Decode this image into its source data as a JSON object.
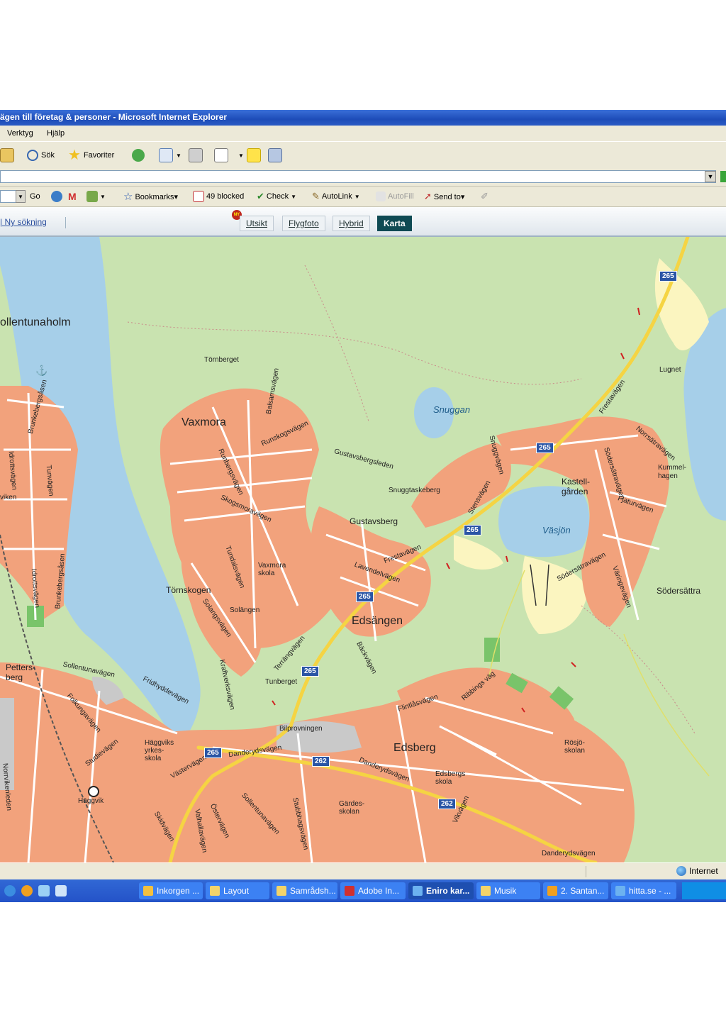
{
  "window": {
    "title": "ägen till företag & personer - Microsoft Internet Explorer"
  },
  "menu": {
    "items": [
      "Verktyg",
      "Hjälp"
    ]
  },
  "toolbar": {
    "search_label": "Sök",
    "favorites_label": "Favoriter"
  },
  "google_toolbar": {
    "go_label": "Go",
    "bookmarks_label": "Bookmarks▾",
    "blocked_label": "49 blocked",
    "check_label": "Check",
    "autolink_label": "AutoLink",
    "autofill_label": "AutoFill",
    "sendto_label": "Send to▾"
  },
  "map_nav": {
    "new_search": "| Ny sökning",
    "badge": "NY",
    "tabs": [
      "Utsikt",
      "Flygfoto",
      "Hybrid",
      "Karta"
    ],
    "active_tab": "Karta"
  },
  "map": {
    "places": {
      "sollentunaholm": "ollentunaholm",
      "vaxmora": "Vaxmora",
      "edsangen": "Edsängen",
      "edsberg": "Edsberg",
      "gustavsberg": "Gustavsberg",
      "kastellgarden": "Kastell-\ngården",
      "tornskogen": "Törnskogen",
      "tornberget": "Törnberget",
      "lugnet": "Lugnet",
      "kummelhagen": "Kummel-\nhagen",
      "sodersattra": "Södersättra",
      "snuggtaskeberg": "Snuggtaskeberg",
      "vaxmora_skola": "Vaxmora\nskola",
      "solangen": "Solängen",
      "tunberget": "Tunberget",
      "bilprovningen": "Bilprovningen",
      "haggviks_skola": "Häggviks\nyrkes-\nskola",
      "haggvik": "Häggvik",
      "edsbergs_skola": "Edsbergs\nskola",
      "rosjo_skolan": "Rösjö-\nskolan",
      "gardesskolan": "Gärdes-\nskolan",
      "pettersberg": "Petters-\nberg",
      "vikens": "viken"
    },
    "water": {
      "snuggan": "Snuggan",
      "vasjon": "Väsjön"
    },
    "roads": {
      "frestavagen": "Frestavägen",
      "gustavsbergsleden": "Gustavsbergsleden",
      "sollentunavagen": "Sollentunavägen",
      "danderydsvagen": "Danderydsvägen",
      "vasterygen": "Västervägen",
      "runskogsvagen": "Runskogsvägen",
      "lavendelvagen": "Lavendelvägen",
      "terrangvagen": "Terrängvägen",
      "backvagen": "Bäckvägen",
      "flintasvagen": "Flintlåsvägen",
      "ribbingsvag": "Ribbings väg",
      "norrsatravagen": "Norrsätravägen",
      "sodersatravagen": "Södersätravägen",
      "fiaturvagen": "Fjaturvägen",
      "varingevagen": "Väringevägen",
      "stensvagen": "Stensvägen",
      "tundalsvagen": "Tundalsvägen",
      "skogsmoravagen": "Skogsmoravägen",
      "runbergsvagen": "Runbergsvägen",
      "balsamsvagen": "Balsamsvägen",
      "solangsvagen": "Solangsvägen",
      "kraftverksvagen": "Kraftverksvägen",
      "fridhyddevagen": "Fridhyddevägen",
      "folkungavagen": "Folkungavägen",
      "studievagen": "Studievägen",
      "norrvikenleden": "Norrvikenleden",
      "brunkebergsasen": "Brunkebergsåsen",
      "idrottsvagen": "Idrottsvägen",
      "tunvagen": "Tunvägen",
      "skidvagen": "Skidvägen",
      "ostervagen": "Östervägen",
      "valhallavagen": "Valhallavägen",
      "stubbhagsvagen": "Stubbhagsvägen",
      "vikvagen": "Vikvägen",
      "snuggvagen": "Snuggvägen"
    },
    "shields": [
      "265",
      "265",
      "265",
      "265",
      "262",
      "262",
      "265",
      "265"
    ]
  },
  "status_bar": {
    "zone_label": "Internet"
  },
  "taskbar": {
    "tasks": [
      "Inkorgen ...",
      "Layout",
      "Samrådsh...",
      "Adobe In...",
      "Eniro kar...",
      "Musik",
      "2. Santan...",
      "hitta.se - ..."
    ],
    "active_task": "Eniro kar..."
  },
  "colors": {
    "map_land": "#c9e3b0",
    "map_water": "#a6cfe9",
    "map_urban": "#f2a27c",
    "map_yellow": "#fbf5c0",
    "road_main": "#f5d443",
    "shield_blue": "#2a55a5",
    "ie_title": "#1d4cb8",
    "karta_tab": "#0f4a53"
  }
}
